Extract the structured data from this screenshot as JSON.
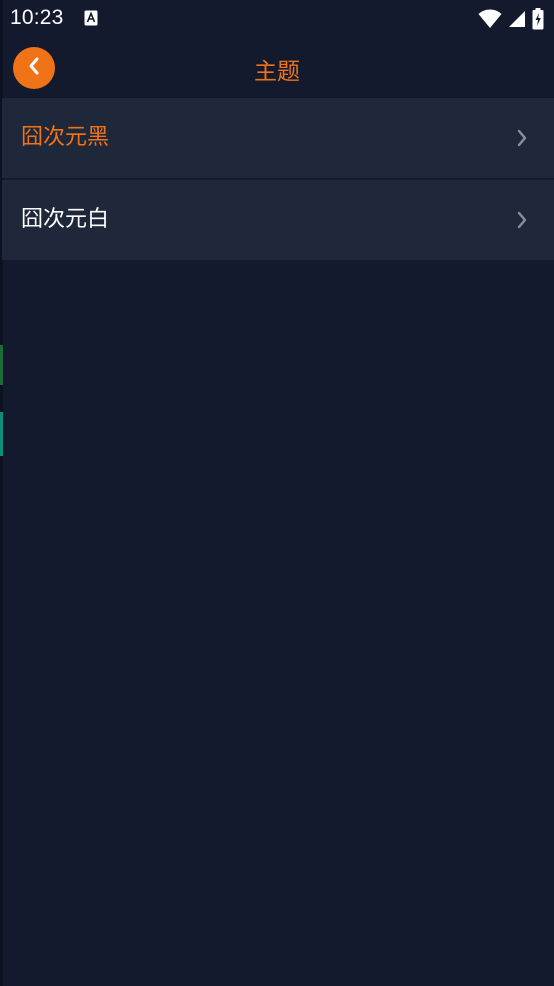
{
  "status_bar": {
    "time": "10:23",
    "icons": [
      "keyboard-a-icon",
      "wifi-icon",
      "signal-icon",
      "battery-charging-icon"
    ]
  },
  "header": {
    "title": "主题",
    "back_icon": "chevron-left-icon"
  },
  "themes": {
    "items": [
      {
        "label": "囧次元黑",
        "selected": true,
        "color": "#f07317"
      },
      {
        "label": "囧次元白",
        "selected": false,
        "color": "#ffffff"
      }
    ],
    "chevron_icon": "chevron-right-icon"
  },
  "colors": {
    "background": "#131a2e",
    "list_item_bg": "#1f283a",
    "accent": "#f07317",
    "text": "#ffffff",
    "chevron": "#8a8f99"
  }
}
